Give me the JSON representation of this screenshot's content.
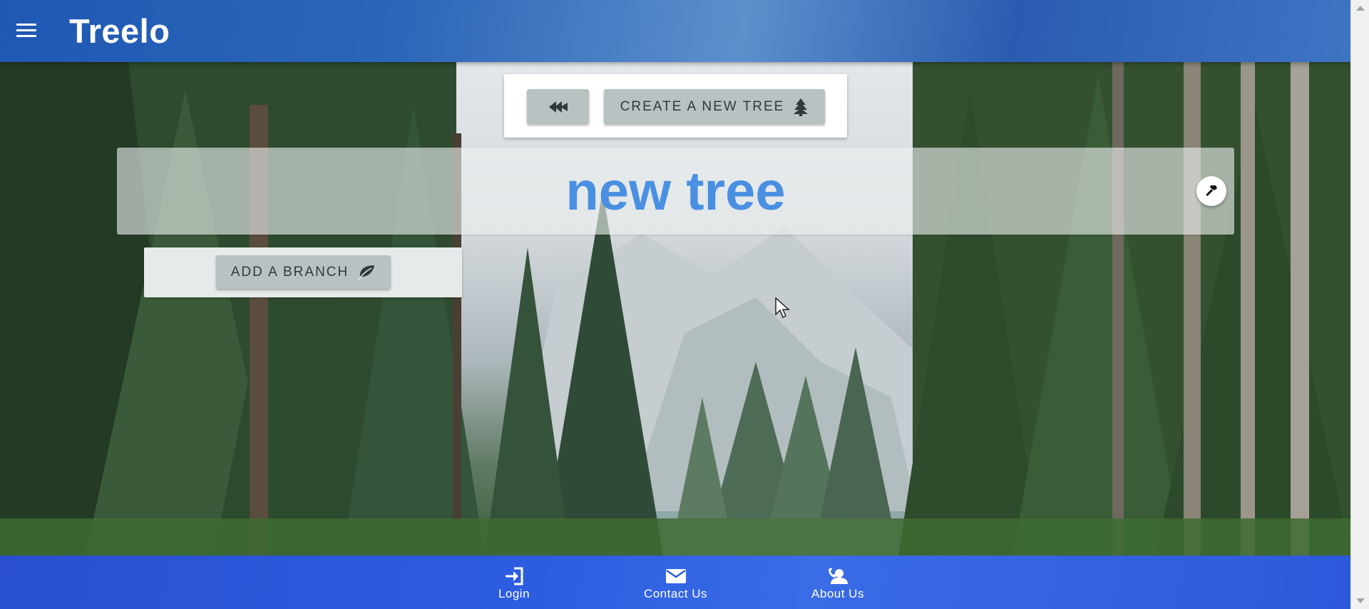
{
  "app": {
    "title": "Treelo"
  },
  "header": {
    "menu_icon": "hamburger-menu-icon"
  },
  "toolbar": {
    "back_icon": "rewind-icon",
    "create_label": "CREATE A NEW TREE",
    "create_icon": "pine-tree-icon"
  },
  "tree": {
    "name": "new tree",
    "edit_icon": "hammer-icon"
  },
  "branch": {
    "add_label": "ADD A BRANCH",
    "add_icon": "leaf-icon"
  },
  "footer": {
    "items": [
      {
        "label": "Login",
        "icon": "login-icon"
      },
      {
        "label": "Contact Us",
        "icon": "envelope-icon"
      },
      {
        "label": "About Us",
        "icon": "contact-phone-icon"
      }
    ]
  },
  "colors": {
    "header": "#2c66b8",
    "footer": "#2c5de0",
    "title_text": "#4a90e2",
    "button": "#b9c2c2"
  }
}
